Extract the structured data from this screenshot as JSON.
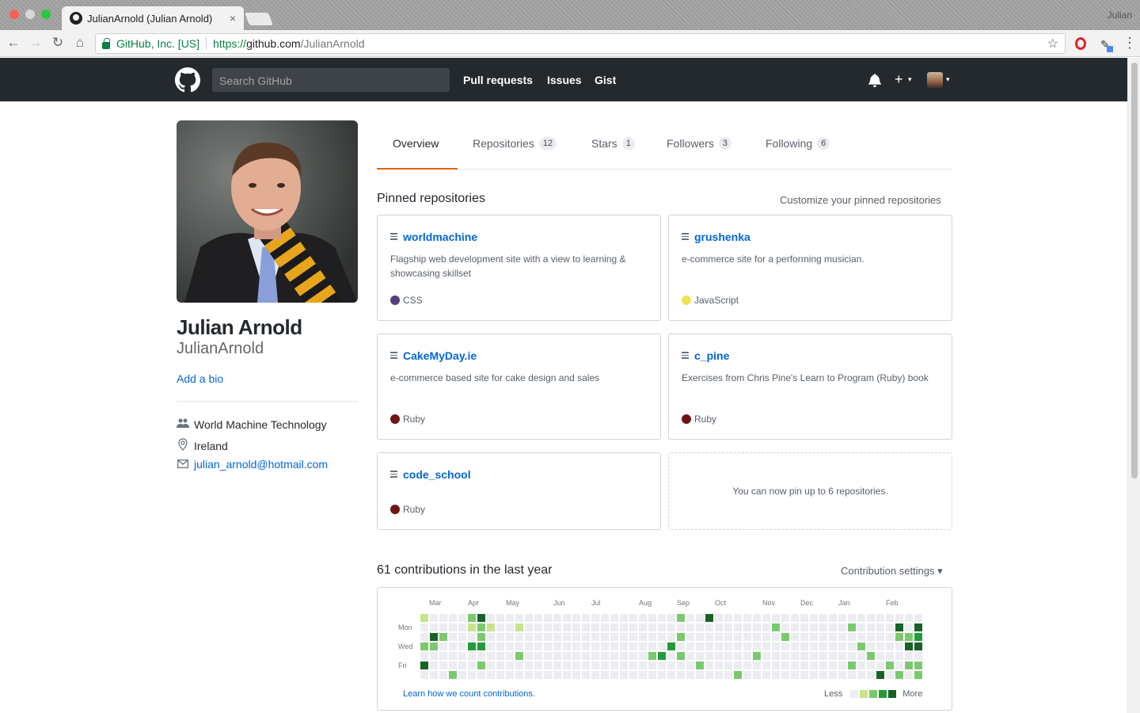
{
  "browser": {
    "tab_title": "JulianArnold (Julian Arnold)",
    "tab_close": "×",
    "profile_name": "Julian",
    "secure_label": "GitHub, Inc. [US]",
    "url_scheme": "https://",
    "url_host": "github.com",
    "url_path": "/JulianArnold",
    "back": "←",
    "forward": "→",
    "reload": "↻",
    "home": "⌂",
    "star": "☆",
    "menu": "⋮"
  },
  "header": {
    "search_placeholder": "Search GitHub",
    "nav": [
      "Pull requests",
      "Issues",
      "Gist"
    ],
    "plus": "+",
    "caret": "▾"
  },
  "profile": {
    "full_name": "Julian Arnold",
    "username": "JulianArnold",
    "add_bio": "Add a bio",
    "organization": "World Machine Technology",
    "location": "Ireland",
    "email": "julian_arnold@hotmail.com",
    "icons": {
      "organization": "organization-icon",
      "location": "location-icon",
      "email": "mail-icon"
    }
  },
  "tabs": [
    {
      "label": "Overview",
      "count": null,
      "selected": true
    },
    {
      "label": "Repositories",
      "count": "12"
    },
    {
      "label": "Stars",
      "count": "1"
    },
    {
      "label": "Followers",
      "count": "3"
    },
    {
      "label": "Following",
      "count": "6"
    }
  ],
  "pinned": {
    "heading": "Pinned repositories",
    "customize": "Customize your pinned repositories",
    "more_note": "You can now pin up to 6 repositories.",
    "repos": [
      {
        "name": "worldmachine",
        "description": "Flagship web development site with a view to learning & showcasing skillset",
        "language": "CSS",
        "lang_color": "#563d7c"
      },
      {
        "name": "grushenka",
        "description": "e-commerce site for a performing musician.",
        "language": "JavaScript",
        "lang_color": "#f1e05a"
      },
      {
        "name": "CakeMyDay.ie",
        "description": "e-commerce based site for cake design and sales",
        "language": "Ruby",
        "lang_color": "#701516"
      },
      {
        "name": "c_pine",
        "description": "Exercises from Chris Pine's Learn to Program (Ruby) book",
        "language": "Ruby",
        "lang_color": "#701516"
      },
      {
        "name": "code_school",
        "description": "",
        "language": "Ruby",
        "lang_color": "#701516"
      }
    ]
  },
  "contributions": {
    "heading": "61 contributions in the last year",
    "settings": "Contribution settings ▾",
    "months": [
      "Mar",
      "Apr",
      "May",
      "Jun",
      "Jul",
      "Aug",
      "Sep",
      "Oct",
      "Nov",
      "Dec",
      "Jan",
      "Feb"
    ],
    "days": [
      "Mon",
      "Wed",
      "Fri"
    ],
    "learn": "Learn how we count contributions.",
    "less": "Less",
    "more": "More",
    "colors": [
      "#ebedf0",
      "#c6e48b",
      "#7bc96f",
      "#239a3b",
      "#196127"
    ],
    "weeks": 53,
    "cells": [
      [
        0,
        0,
        1
      ],
      [
        0,
        3,
        2
      ],
      [
        0,
        5,
        4
      ],
      [
        1,
        2,
        4
      ],
      [
        1,
        3,
        2
      ],
      [
        2,
        2,
        2
      ],
      [
        3,
        6,
        2
      ],
      [
        5,
        0,
        2
      ],
      [
        5,
        1,
        1
      ],
      [
        5,
        3,
        3
      ],
      [
        6,
        0,
        4
      ],
      [
        6,
        1,
        2
      ],
      [
        6,
        2,
        2
      ],
      [
        6,
        3,
        3
      ],
      [
        6,
        5,
        2
      ],
      [
        7,
        1,
        1
      ],
      [
        10,
        1,
        1
      ],
      [
        10,
        4,
        2
      ],
      [
        24,
        4,
        2
      ],
      [
        25,
        4,
        3
      ],
      [
        26,
        3,
        3
      ],
      [
        27,
        0,
        2
      ],
      [
        27,
        2,
        2
      ],
      [
        27,
        4,
        2
      ],
      [
        29,
        5,
        2
      ],
      [
        30,
        0,
        4
      ],
      [
        33,
        6,
        2
      ],
      [
        35,
        4,
        2
      ],
      [
        37,
        1,
        2
      ],
      [
        38,
        2,
        2
      ],
      [
        45,
        1,
        2
      ],
      [
        45,
        5,
        2
      ],
      [
        46,
        3,
        2
      ],
      [
        47,
        4,
        2
      ],
      [
        48,
        6,
        4
      ],
      [
        49,
        5,
        2
      ],
      [
        50,
        1,
        4
      ],
      [
        50,
        2,
        2
      ],
      [
        50,
        6,
        2
      ],
      [
        51,
        2,
        2
      ],
      [
        51,
        3,
        4
      ],
      [
        52,
        1,
        4
      ],
      [
        52,
        2,
        3
      ],
      [
        52,
        3,
        4
      ],
      [
        52,
        5,
        2
      ],
      [
        52,
        6,
        2
      ],
      [
        51,
        5,
        2
      ]
    ]
  }
}
